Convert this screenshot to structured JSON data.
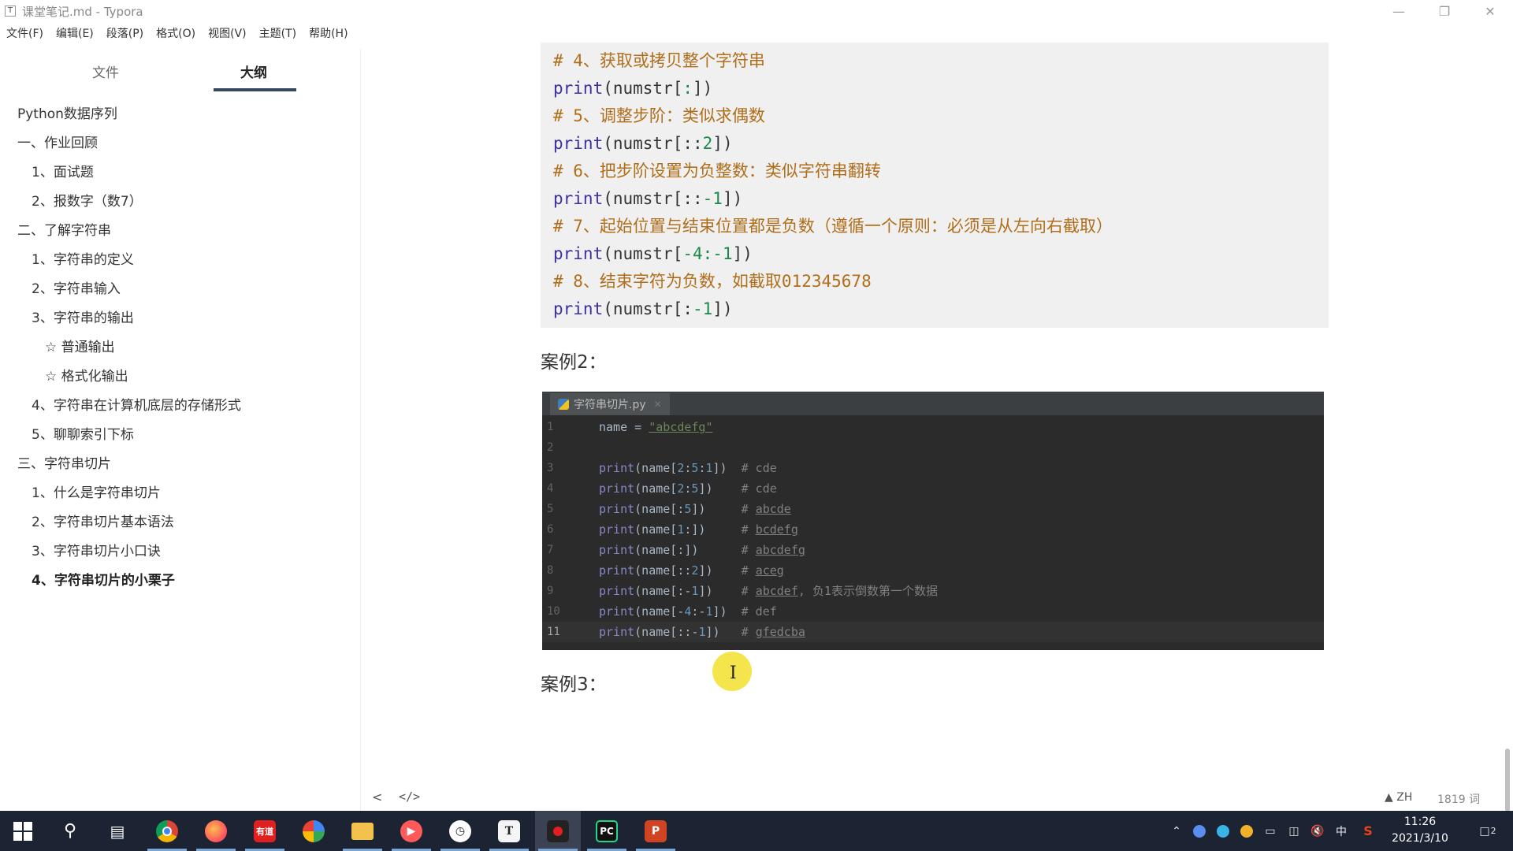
{
  "window": {
    "title": "课堂笔记.md - Typora",
    "app_icon": "T"
  },
  "menu": [
    "文件(F)",
    "编辑(E)",
    "段落(P)",
    "格式(O)",
    "视图(V)",
    "主题(T)",
    "帮助(H)"
  ],
  "sidebar": {
    "tabs": [
      "文件",
      "大纲"
    ],
    "active_tab": "大纲",
    "outline": [
      "Python数据序列",
      "一、作业回顾",
      "1、面试题",
      "2、报数字（数7）",
      "二、了解字符串",
      "1、字符串的定义",
      "2、字符串输入",
      "3、字符串的输出",
      "☆ 普通输出",
      "☆ 格式化输出",
      "4、字符串在计算机底层的存储形式",
      "5、聊聊索引下标",
      "三、字符串切片",
      "1、什么是字符串切片",
      "2、字符串切片基本语法",
      "3、字符串切片小口诀",
      "4、字符串切片的小栗子"
    ],
    "active_item": "4、字符串切片的小栗子"
  },
  "code_block": [
    {
      "kind": "comment",
      "text": "# 4、获取或拷贝整个字符串"
    },
    {
      "kind": "print",
      "fn": "print",
      "open": "(numstr[",
      "num": ":",
      "close": "])"
    },
    {
      "kind": "comment",
      "text": "# 5、调整步阶：类似求偶数"
    },
    {
      "kind": "print",
      "fn": "print",
      "open": "(numstr[::",
      "num": "2",
      "close": "])"
    },
    {
      "kind": "comment",
      "text": "# 6、把步阶设置为负整数：类似字符串翻转"
    },
    {
      "kind": "print",
      "fn": "print",
      "open": "(numstr[::",
      "num": "-1",
      "close": "])"
    },
    {
      "kind": "comment",
      "text": "# 7、起始位置与结束位置都是负数（遵循一个原则：必须是从左向右截取）"
    },
    {
      "kind": "print",
      "fn": "print",
      "open": "(numstr[",
      "num": "-4:-1",
      "close": "])"
    },
    {
      "kind": "comment",
      "text": "# 8、结束字符为负数，如截取012345678"
    },
    {
      "kind": "print",
      "fn": "print",
      "open": "(numstr[:",
      "num": "-1",
      "close": "])"
    }
  ],
  "headings": {
    "case2": "案例2：",
    "case3": "案例3："
  },
  "ide": {
    "tab_name": "字符串切片.py",
    "lines": [
      {
        "n": "1",
        "pre": "name = ",
        "str": "\"abcdefg\"",
        "cm": ""
      },
      {
        "n": "2",
        "pre": "",
        "str": "",
        "cm": ""
      },
      {
        "n": "3",
        "fn": "print",
        "args": "(name[2:5:1])",
        "pad": "  ",
        "cm": "# cde"
      },
      {
        "n": "4",
        "fn": "print",
        "args": "(name[2:5])",
        "pad": "    ",
        "cm": "# cde"
      },
      {
        "n": "5",
        "fn": "print",
        "args": "(name[:5])",
        "pad": "     ",
        "cm": "# abcde"
      },
      {
        "n": "6",
        "fn": "print",
        "args": "(name[1:])",
        "pad": "     ",
        "cm": "# bcdefg"
      },
      {
        "n": "7",
        "fn": "print",
        "args": "(name[:])",
        "pad": "      ",
        "cm": "# abcdefg"
      },
      {
        "n": "8",
        "fn": "print",
        "args": "(name[::2])",
        "pad": "    ",
        "cm": "# aceg"
      },
      {
        "n": "9",
        "fn": "print",
        "args": "(name[:-1])",
        "pad": "    ",
        "cm": "# abcdef, 负1表示倒数第一个数据"
      },
      {
        "n": "10",
        "fn": "print",
        "args": "(name[-4:-1])",
        "pad": "  ",
        "cm": "# def"
      },
      {
        "n": "11",
        "fn": "print",
        "args": "(name[::-1])",
        "pad": "   ",
        "cm": "# gfedcba"
      }
    ]
  },
  "status": {
    "back": "<",
    "source": "</>",
    "lang": "ZH",
    "words": "1819 词"
  },
  "taskbar": {
    "apps": [
      "start",
      "search",
      "task-view",
      "chrome",
      "firefox",
      "youdao",
      "google-drive",
      "file-explorer",
      "screen-capture",
      "clock-app",
      "typora",
      "recorder",
      "pycharm",
      "powerpoint"
    ],
    "time": "11:26",
    "date": "2021/3/10",
    "ime": "中",
    "notification_count": "2"
  }
}
